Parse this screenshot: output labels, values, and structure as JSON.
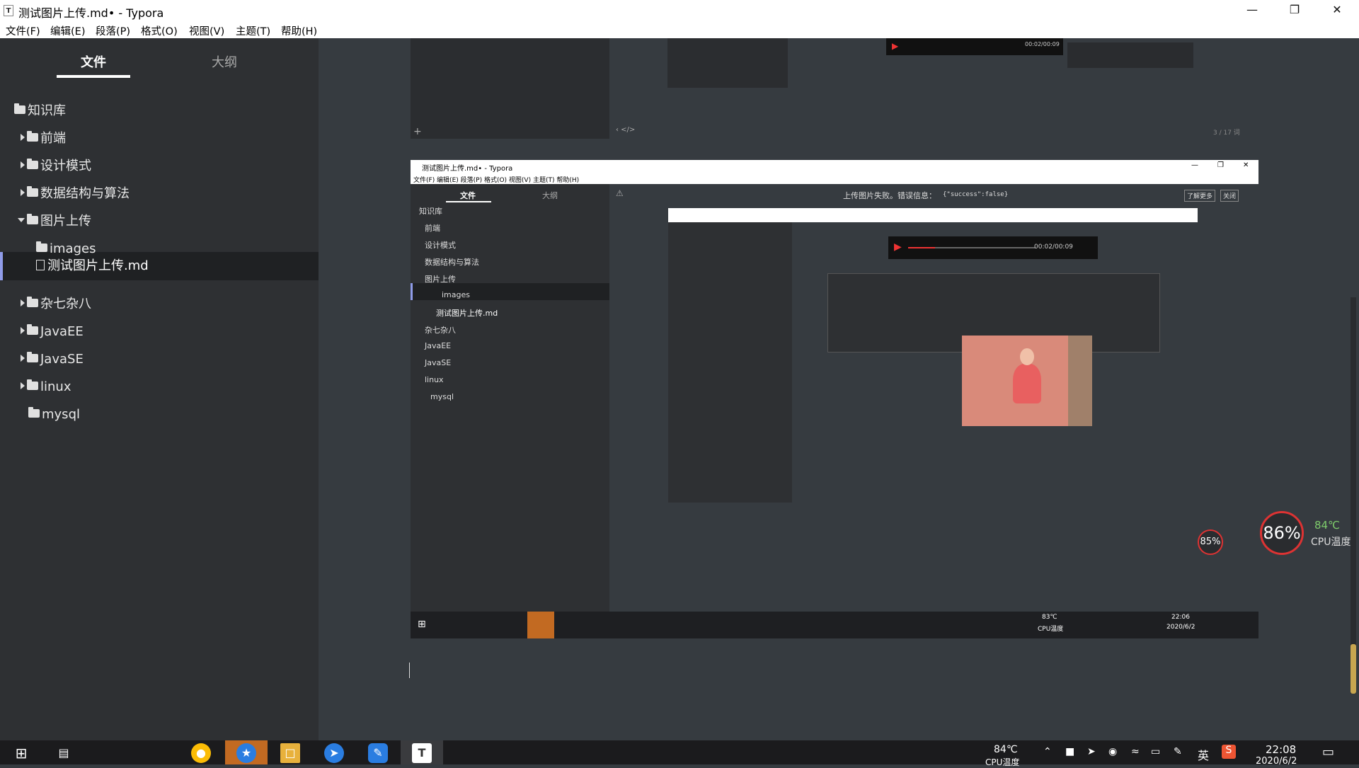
{
  "window": {
    "title": "测试图片上传.md• - Typora",
    "app_icon": "T",
    "minimize_icon": "minimize-icon",
    "maximize_icon": "restore-icon",
    "close_icon": "close-icon"
  },
  "menu": [
    "文件(F)",
    "编辑(E)",
    "段落(P)",
    "格式(O)",
    "视图(V)",
    "主题(T)",
    "帮助(H)"
  ],
  "sidebar": {
    "tabs": [
      "文件",
      "大纲"
    ],
    "root": "知识库",
    "items": [
      {
        "label": "前端",
        "type": "folder",
        "expanded": false
      },
      {
        "label": "设计模式",
        "type": "folder",
        "expanded": false
      },
      {
        "label": "数据结构与算法",
        "type": "folder",
        "expanded": false
      },
      {
        "label": "图片上传",
        "type": "folder",
        "expanded": true
      },
      {
        "label": "images",
        "type": "folder",
        "expanded": false
      },
      {
        "label": "测试图片上传.md",
        "type": "file",
        "selected": true
      },
      {
        "label": "杂七杂八",
        "type": "folder",
        "expanded": false
      },
      {
        "label": "JavaEE",
        "type": "folder",
        "expanded": false
      },
      {
        "label": "JavaSE",
        "type": "folder",
        "expanded": false
      },
      {
        "label": "linux",
        "type": "folder",
        "expanded": false
      },
      {
        "label": "mysql",
        "type": "folder",
        "expanded": false
      }
    ]
  },
  "embedded": {
    "title": "测试图片上传.md• - Typora",
    "menu": "文件(F)   编辑(E)   段落(P)   格式(O)   视图(V)   主题(T)   帮助(H)",
    "notice": "上传图片失败。错误信息：",
    "notice_code": "{\"success\":false}",
    "learn_more": "了解更多",
    "close": "关闭",
    "tabs": [
      "文件",
      "大纲"
    ],
    "items": [
      "知识库",
      "前端",
      "设计模式",
      "数据结构与算法",
      "图片上传",
      "images",
      "测试图片上传.md",
      "杂七杂八",
      "JavaEE",
      "JavaSE",
      "linux",
      "mysql"
    ],
    "word_count_top": "3 / 17 词",
    "video_time": "00:02/00:09",
    "taskbar_temp": "83℃",
    "taskbar_temp_label": "CPU温度",
    "taskbar_time": "22:06",
    "taskbar_date": "2020/6/2"
  },
  "cpu_widget": {
    "percent": "86%",
    "temp": "84℃",
    "label": "CPU温度",
    "ring_color": "#dd3333"
  },
  "taskbar": {
    "temp": "84℃",
    "temp_label": "CPU温度",
    "ime": "英",
    "time": "22:08",
    "date": "2020/6/2"
  }
}
